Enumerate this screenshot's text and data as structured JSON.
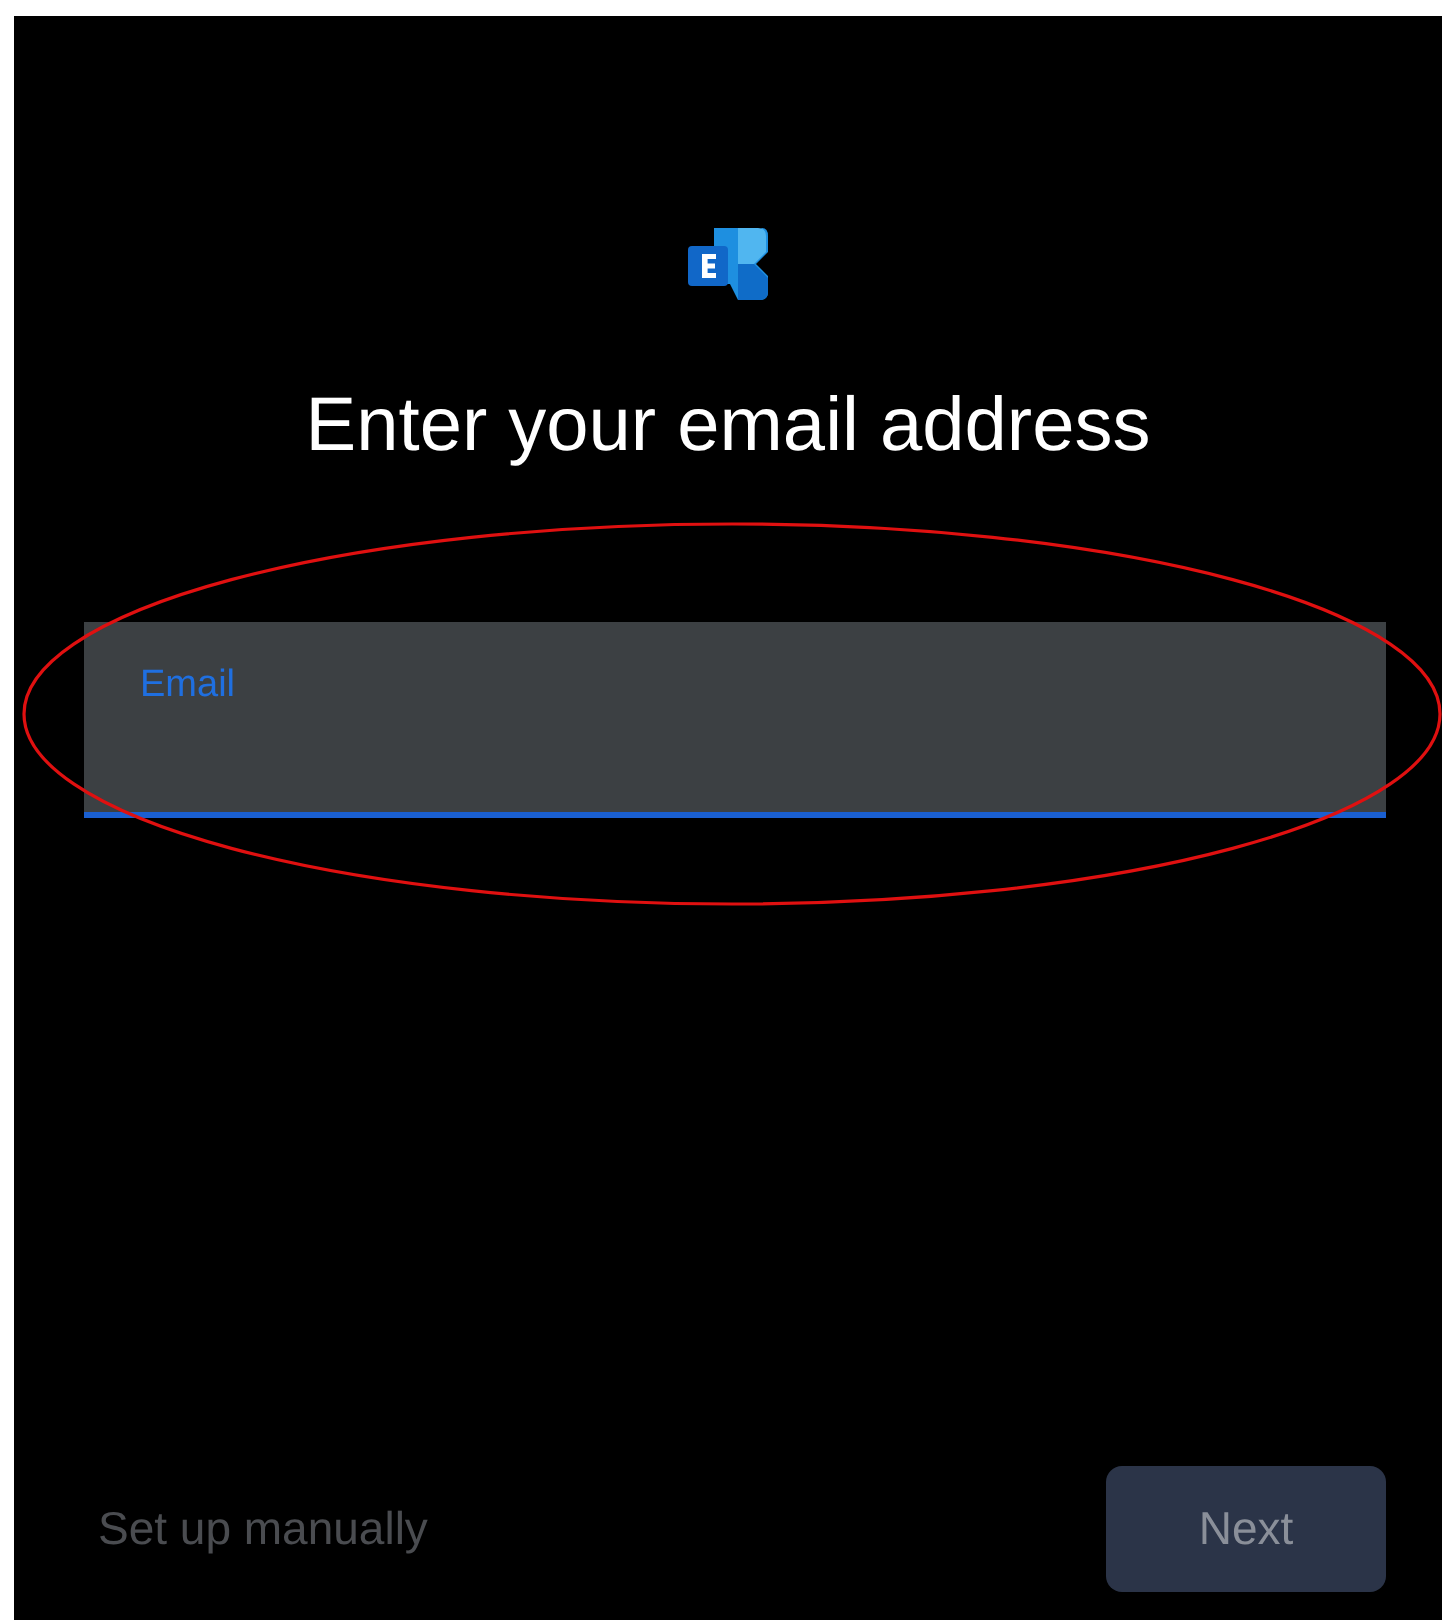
{
  "title": "Enter your email address",
  "email_field": {
    "label": "Email",
    "focused": true
  },
  "annotation": {
    "kind": "ellipse"
  },
  "set_up_manually": {
    "label": "Set up manually",
    "disabled": true
  },
  "next_button": {
    "label": "Next",
    "disabled": true
  }
}
